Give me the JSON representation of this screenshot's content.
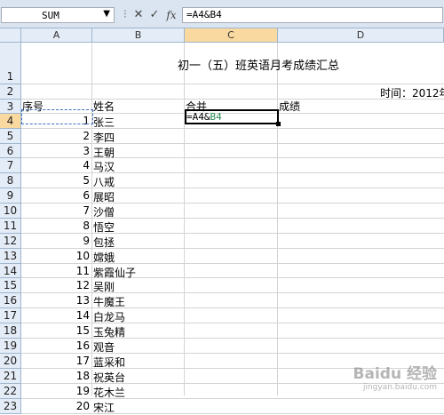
{
  "formula_bar": {
    "name_box": "SUM",
    "tools": {
      "cancel": "✕",
      "enter": "✓",
      "fx": "fx"
    },
    "formula": "=A4&B4"
  },
  "columns": [
    "A",
    "B",
    "C",
    "D"
  ],
  "rows": [
    "1",
    "2",
    "3",
    "4",
    "5",
    "6",
    "7",
    "8",
    "9",
    "10",
    "11",
    "12",
    "13",
    "14",
    "15",
    "16",
    "17",
    "18",
    "19",
    "20",
    "21",
    "22",
    "23"
  ],
  "sheet": {
    "title": "初一（五）班英语月考成绩汇总",
    "time_label": "时间：2012年",
    "headers": {
      "seq": "序号",
      "name": "姓名",
      "merge": "合并",
      "score": "成绩"
    },
    "editing": {
      "prefix": "=A4&",
      "ref": "B4"
    },
    "students": [
      {
        "no": "1",
        "name": "张三"
      },
      {
        "no": "2",
        "name": "李四"
      },
      {
        "no": "3",
        "name": "王朝"
      },
      {
        "no": "4",
        "name": "马汉"
      },
      {
        "no": "5",
        "name": "八戒"
      },
      {
        "no": "6",
        "name": "展昭"
      },
      {
        "no": "7",
        "name": "沙僧"
      },
      {
        "no": "8",
        "name": "悟空"
      },
      {
        "no": "9",
        "name": "包拯"
      },
      {
        "no": "10",
        "name": "嫦娥"
      },
      {
        "no": "11",
        "name": "紫霞仙子"
      },
      {
        "no": "12",
        "name": "吴刚"
      },
      {
        "no": "13",
        "name": "牛魔王"
      },
      {
        "no": "14",
        "name": "白龙马"
      },
      {
        "no": "15",
        "name": "玉兔精"
      },
      {
        "no": "16",
        "name": "观音"
      },
      {
        "no": "17",
        "name": "蓝采和"
      },
      {
        "no": "18",
        "name": "祝英台"
      },
      {
        "no": "19",
        "name": "花木兰"
      },
      {
        "no": "20",
        "name": "宋江"
      }
    ]
  },
  "watermark": {
    "main": "Baidu 经验",
    "sub": "jingyan.baidu.com"
  },
  "colors": {
    "header_bg": "#e4ecf7",
    "selected_header": "#f9d99f",
    "ref_color": "#2e8b57",
    "ribbon_bg": "#dbe5f1"
  }
}
